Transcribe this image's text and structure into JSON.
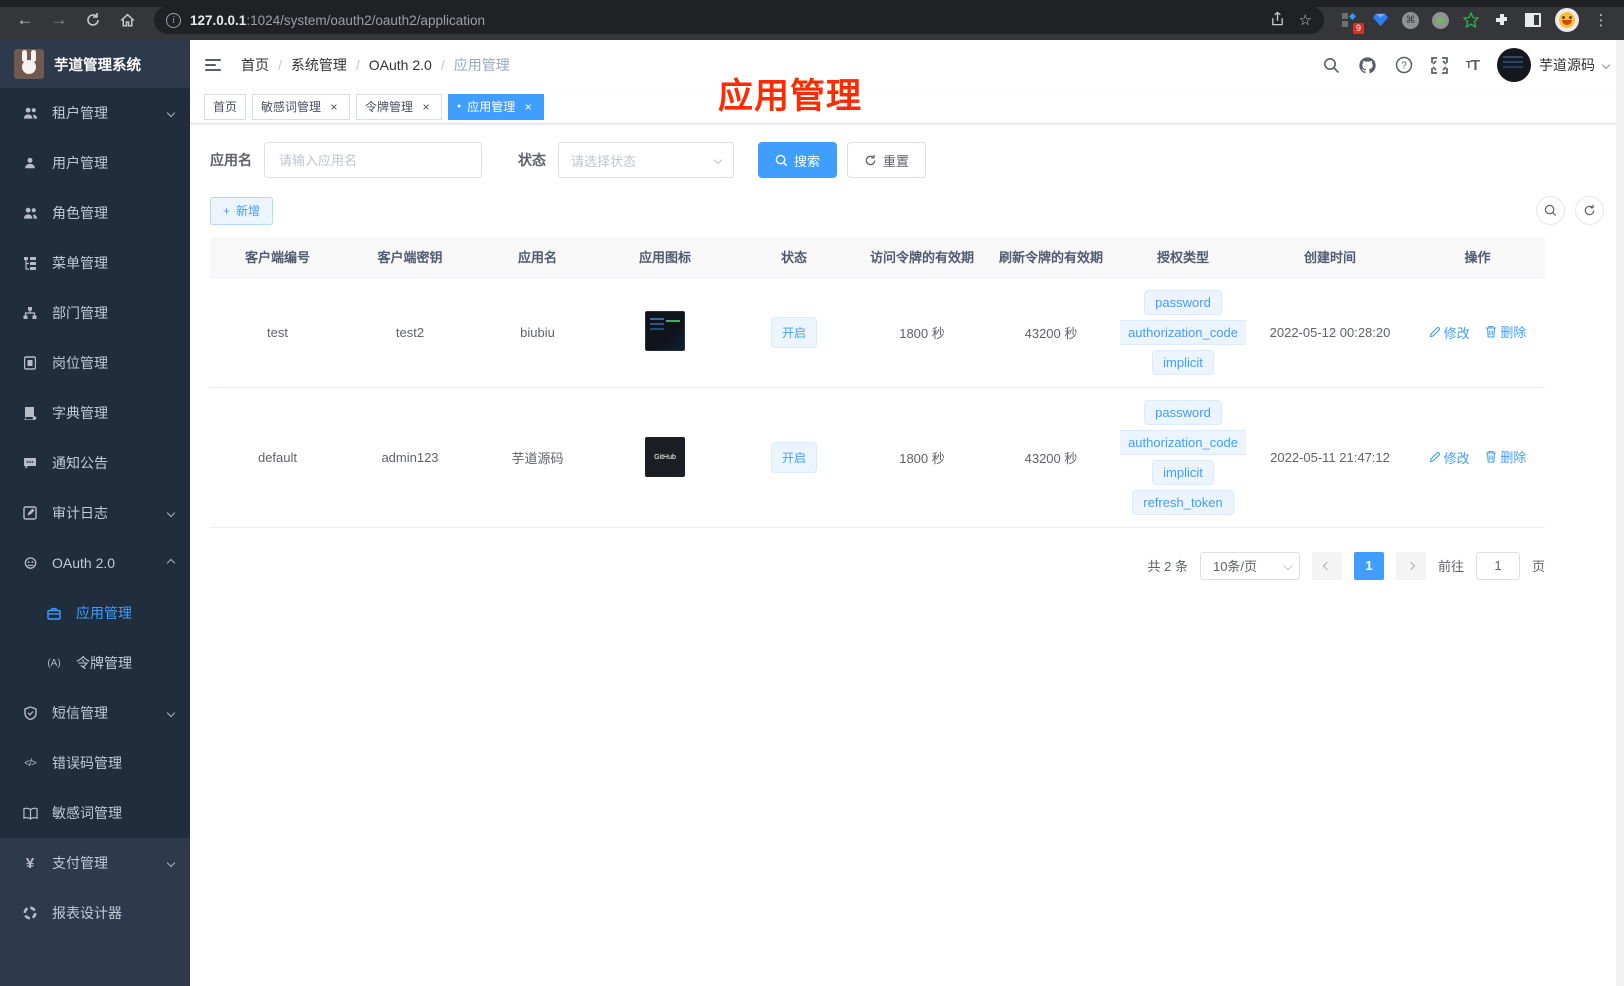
{
  "icons": {
    "back": "←",
    "forward": "→",
    "home": "⌂",
    "kebab": "⋮",
    "star": "☆",
    "close": "×",
    "dot": "●",
    "plus": "+",
    "slash": "/",
    "info": "i",
    "command": "⌘",
    "yen": "¥",
    "code": "</>",
    "token": "(A)"
  },
  "browser": {
    "url_host": "127.0.0.1",
    "url_rest": ":1024/system/oauth2/oauth2/application",
    "extension_badge": "9"
  },
  "sidebar": {
    "logo_title": "芋道管理系统",
    "items": [
      {
        "label": "租户管理"
      },
      {
        "label": "用户管理"
      },
      {
        "label": "角色管理"
      },
      {
        "label": "菜单管理"
      },
      {
        "label": "部门管理"
      },
      {
        "label": "岗位管理"
      },
      {
        "label": "字典管理"
      },
      {
        "label": "通知公告"
      },
      {
        "label": "审计日志"
      },
      {
        "label": "OAuth 2.0"
      },
      {
        "label": "应用管理"
      },
      {
        "label": "令牌管理"
      },
      {
        "label": "短信管理"
      },
      {
        "label": "错误码管理"
      },
      {
        "label": "敏感词管理"
      },
      {
        "label": "支付管理"
      },
      {
        "label": "报表设计器"
      }
    ]
  },
  "header": {
    "breadcrumb": [
      "首页",
      "系统管理",
      "OAuth 2.0",
      "应用管理"
    ],
    "username": "芋道源码"
  },
  "annotation": {
    "text": "应用管理"
  },
  "tabs": [
    {
      "label": "首页"
    },
    {
      "label": "敏感词管理"
    },
    {
      "label": "令牌管理"
    },
    {
      "label": "应用管理"
    }
  ],
  "filter": {
    "name_label": "应用名",
    "name_placeholder": "请输入应用名",
    "status_label": "状态",
    "status_placeholder": "请选择状态",
    "search_label": "搜索",
    "reset_label": "重置",
    "add_label": "新增"
  },
  "table": {
    "columns": [
      "客户端编号",
      "客户端密钥",
      "应用名",
      "应用图标",
      "状态",
      "访问令牌的有效期",
      "刷新令牌的有效期",
      "授权类型",
      "创建时间",
      "操作"
    ],
    "rows": [
      {
        "client_id": "test",
        "secret": "test2",
        "name": "biubiu",
        "status": "开启",
        "access_ttl": "1800 秒",
        "refresh_ttl": "43200 秒",
        "grant_types": [
          "password",
          "authorization_code",
          "implicit"
        ],
        "create_time": "2022-05-12 00:28:20",
        "edit_label": "修改",
        "delete_label": "删除"
      },
      {
        "client_id": "default",
        "secret": "admin123",
        "name": "芋道源码",
        "icon_text": "GitHub",
        "status": "开启",
        "access_ttl": "1800 秒",
        "refresh_ttl": "43200 秒",
        "grant_types": [
          "password",
          "authorization_code",
          "implicit",
          "refresh_token"
        ],
        "create_time": "2022-05-11 21:47:12",
        "edit_label": "修改",
        "delete_label": "删除"
      }
    ]
  },
  "pagination": {
    "total_text": "共 2 条",
    "page_size": "10条/页",
    "current_page": "1",
    "goto_label": "前往",
    "goto_value": "1",
    "page_unit": "页"
  }
}
